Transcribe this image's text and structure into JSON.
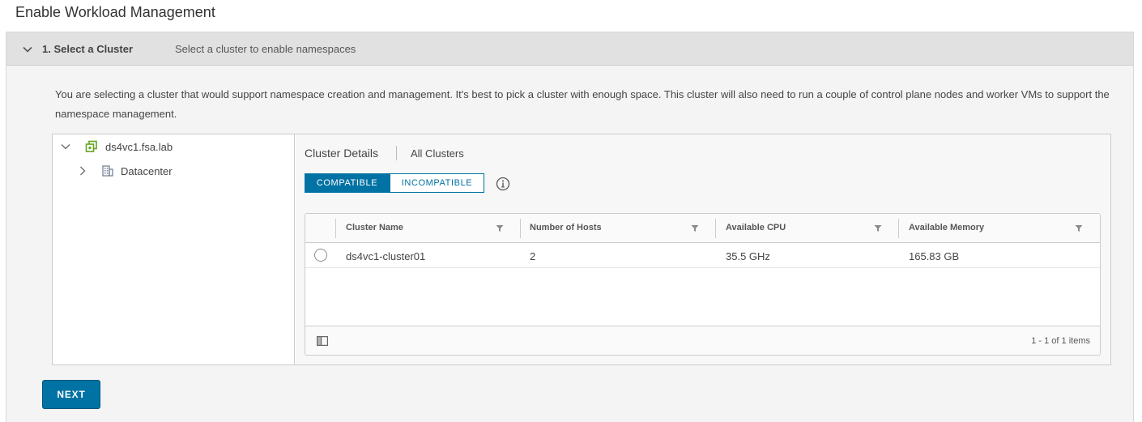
{
  "page": {
    "title": "Enable Workload Management"
  },
  "step": {
    "title": "1. Select a Cluster",
    "description": "Select a cluster to enable namespaces",
    "intro": "You are selecting a cluster that would support namespace creation and management. It's best to pick a cluster with enough space. This cluster will also need to run a couple of control plane nodes and worker VMs to support the namespace management."
  },
  "tree": {
    "root": {
      "label": "ds4vc1.fsa.lab",
      "icon": "vcenter-icon",
      "expanded": true
    },
    "children": [
      {
        "label": "Datacenter",
        "icon": "datacenter-icon",
        "expanded": false
      }
    ]
  },
  "details": {
    "title": "Cluster Details",
    "all_clusters_link": "All Clusters",
    "tabs": {
      "compatible": "COMPATIBLE",
      "incompatible": "INCOMPATIBLE",
      "active": "compatible"
    }
  },
  "grid": {
    "columns": [
      "Cluster Name",
      "Number of Hosts",
      "Available CPU",
      "Available Memory"
    ],
    "rows": [
      {
        "name": "ds4vc1-cluster01",
        "hosts": "2",
        "cpu": "35.5 GHz",
        "memory": "165.83 GB",
        "selected": false
      }
    ],
    "pagination": "1 - 1 of 1 items"
  },
  "actions": {
    "next_label": "NEXT"
  },
  "colors": {
    "accent": "#0072a3",
    "vcenter_green": "#62a420",
    "header_gray": "#e1e1e1"
  }
}
